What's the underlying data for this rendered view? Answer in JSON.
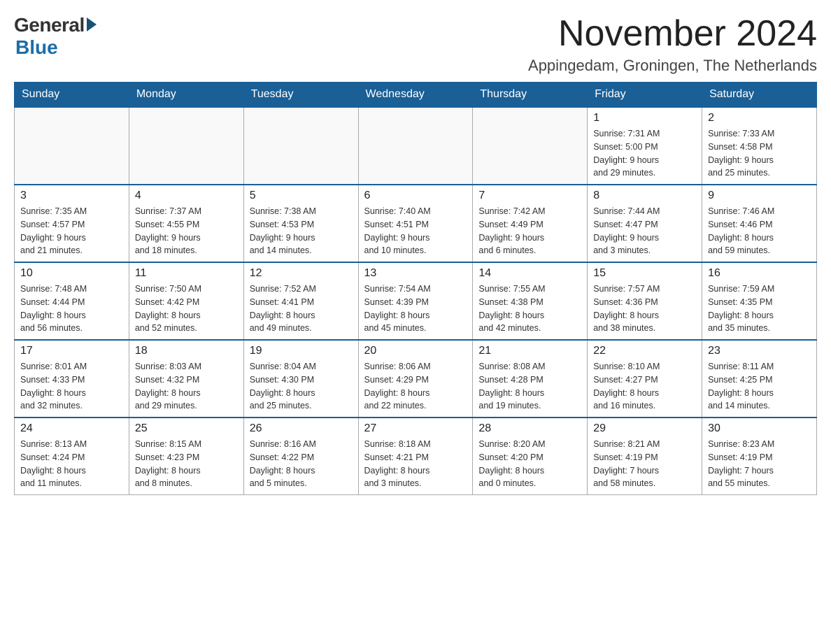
{
  "logo": {
    "general": "General",
    "blue": "Blue"
  },
  "title": "November 2024",
  "location": "Appingedam, Groningen, The Netherlands",
  "days_header": [
    "Sunday",
    "Monday",
    "Tuesday",
    "Wednesday",
    "Thursday",
    "Friday",
    "Saturday"
  ],
  "weeks": [
    [
      {
        "day": "",
        "info": ""
      },
      {
        "day": "",
        "info": ""
      },
      {
        "day": "",
        "info": ""
      },
      {
        "day": "",
        "info": ""
      },
      {
        "day": "",
        "info": ""
      },
      {
        "day": "1",
        "info": "Sunrise: 7:31 AM\nSunset: 5:00 PM\nDaylight: 9 hours\nand 29 minutes."
      },
      {
        "day": "2",
        "info": "Sunrise: 7:33 AM\nSunset: 4:58 PM\nDaylight: 9 hours\nand 25 minutes."
      }
    ],
    [
      {
        "day": "3",
        "info": "Sunrise: 7:35 AM\nSunset: 4:57 PM\nDaylight: 9 hours\nand 21 minutes."
      },
      {
        "day": "4",
        "info": "Sunrise: 7:37 AM\nSunset: 4:55 PM\nDaylight: 9 hours\nand 18 minutes."
      },
      {
        "day": "5",
        "info": "Sunrise: 7:38 AM\nSunset: 4:53 PM\nDaylight: 9 hours\nand 14 minutes."
      },
      {
        "day": "6",
        "info": "Sunrise: 7:40 AM\nSunset: 4:51 PM\nDaylight: 9 hours\nand 10 minutes."
      },
      {
        "day": "7",
        "info": "Sunrise: 7:42 AM\nSunset: 4:49 PM\nDaylight: 9 hours\nand 6 minutes."
      },
      {
        "day": "8",
        "info": "Sunrise: 7:44 AM\nSunset: 4:47 PM\nDaylight: 9 hours\nand 3 minutes."
      },
      {
        "day": "9",
        "info": "Sunrise: 7:46 AM\nSunset: 4:46 PM\nDaylight: 8 hours\nand 59 minutes."
      }
    ],
    [
      {
        "day": "10",
        "info": "Sunrise: 7:48 AM\nSunset: 4:44 PM\nDaylight: 8 hours\nand 56 minutes."
      },
      {
        "day": "11",
        "info": "Sunrise: 7:50 AM\nSunset: 4:42 PM\nDaylight: 8 hours\nand 52 minutes."
      },
      {
        "day": "12",
        "info": "Sunrise: 7:52 AM\nSunset: 4:41 PM\nDaylight: 8 hours\nand 49 minutes."
      },
      {
        "day": "13",
        "info": "Sunrise: 7:54 AM\nSunset: 4:39 PM\nDaylight: 8 hours\nand 45 minutes."
      },
      {
        "day": "14",
        "info": "Sunrise: 7:55 AM\nSunset: 4:38 PM\nDaylight: 8 hours\nand 42 minutes."
      },
      {
        "day": "15",
        "info": "Sunrise: 7:57 AM\nSunset: 4:36 PM\nDaylight: 8 hours\nand 38 minutes."
      },
      {
        "day": "16",
        "info": "Sunrise: 7:59 AM\nSunset: 4:35 PM\nDaylight: 8 hours\nand 35 minutes."
      }
    ],
    [
      {
        "day": "17",
        "info": "Sunrise: 8:01 AM\nSunset: 4:33 PM\nDaylight: 8 hours\nand 32 minutes."
      },
      {
        "day": "18",
        "info": "Sunrise: 8:03 AM\nSunset: 4:32 PM\nDaylight: 8 hours\nand 29 minutes."
      },
      {
        "day": "19",
        "info": "Sunrise: 8:04 AM\nSunset: 4:30 PM\nDaylight: 8 hours\nand 25 minutes."
      },
      {
        "day": "20",
        "info": "Sunrise: 8:06 AM\nSunset: 4:29 PM\nDaylight: 8 hours\nand 22 minutes."
      },
      {
        "day": "21",
        "info": "Sunrise: 8:08 AM\nSunset: 4:28 PM\nDaylight: 8 hours\nand 19 minutes."
      },
      {
        "day": "22",
        "info": "Sunrise: 8:10 AM\nSunset: 4:27 PM\nDaylight: 8 hours\nand 16 minutes."
      },
      {
        "day": "23",
        "info": "Sunrise: 8:11 AM\nSunset: 4:25 PM\nDaylight: 8 hours\nand 14 minutes."
      }
    ],
    [
      {
        "day": "24",
        "info": "Sunrise: 8:13 AM\nSunset: 4:24 PM\nDaylight: 8 hours\nand 11 minutes."
      },
      {
        "day": "25",
        "info": "Sunrise: 8:15 AM\nSunset: 4:23 PM\nDaylight: 8 hours\nand 8 minutes."
      },
      {
        "day": "26",
        "info": "Sunrise: 8:16 AM\nSunset: 4:22 PM\nDaylight: 8 hours\nand 5 minutes."
      },
      {
        "day": "27",
        "info": "Sunrise: 8:18 AM\nSunset: 4:21 PM\nDaylight: 8 hours\nand 3 minutes."
      },
      {
        "day": "28",
        "info": "Sunrise: 8:20 AM\nSunset: 4:20 PM\nDaylight: 8 hours\nand 0 minutes."
      },
      {
        "day": "29",
        "info": "Sunrise: 8:21 AM\nSunset: 4:19 PM\nDaylight: 7 hours\nand 58 minutes."
      },
      {
        "day": "30",
        "info": "Sunrise: 8:23 AM\nSunset: 4:19 PM\nDaylight: 7 hours\nand 55 minutes."
      }
    ]
  ]
}
